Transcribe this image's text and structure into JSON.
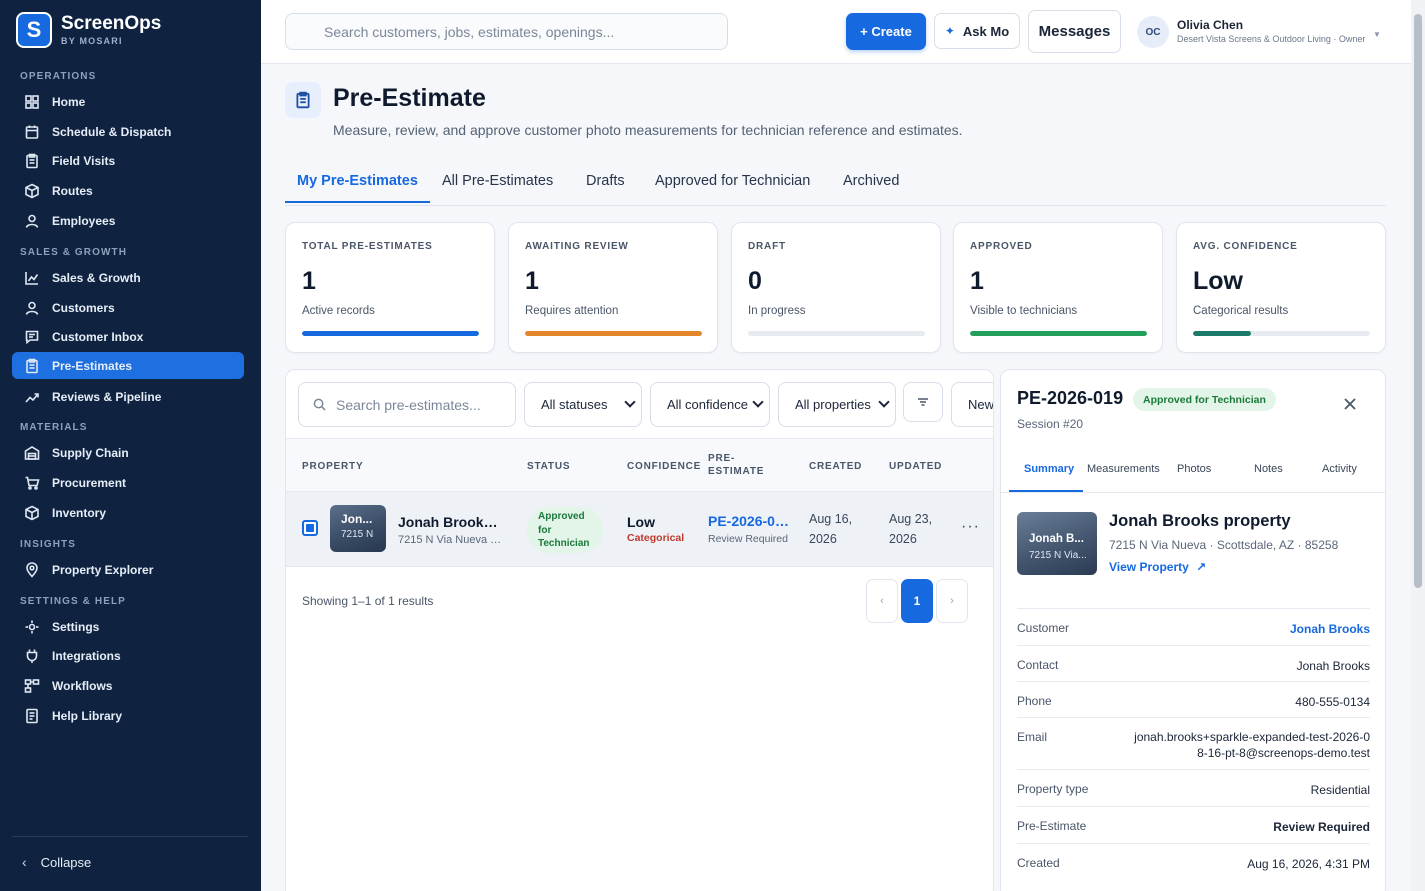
{
  "brand": {
    "logo_letter": "S",
    "name": "ScreenOps",
    "sub": "BY MOSARI"
  },
  "sidebar": {
    "sections": {
      "operations": "OPERATIONS",
      "sales": "SALES & GROWTH",
      "materials": "MATERIALS",
      "insights": "INSIGHTS",
      "settings": "SETTINGS & HELP"
    },
    "items": [
      {
        "label": "Home",
        "icon": "grid-icon"
      },
      {
        "label": "Schedule & Dispatch",
        "icon": "calendar-icon"
      },
      {
        "label": "Field Visits",
        "icon": "clipboard-icon"
      },
      {
        "label": "Routes",
        "icon": "cube-icon"
      },
      {
        "label": "Employees",
        "icon": "user-icon"
      },
      {
        "label": "Sales & Growth",
        "icon": "chart-icon"
      },
      {
        "label": "Customers",
        "icon": "user-icon"
      },
      {
        "label": "Customer Inbox",
        "icon": "message-icon"
      },
      {
        "label": "Pre-Estimates",
        "icon": "clipboard-icon"
      },
      {
        "label": "Reviews & Pipeline",
        "icon": "trend-icon"
      },
      {
        "label": "Supply Chain",
        "icon": "warehouse-icon"
      },
      {
        "label": "Procurement",
        "icon": "cart-icon"
      },
      {
        "label": "Inventory",
        "icon": "cube-icon"
      },
      {
        "label": "Property Explorer",
        "icon": "pin-icon"
      },
      {
        "label": "Settings",
        "icon": "gear-icon"
      },
      {
        "label": "Integrations",
        "icon": "plug-icon"
      },
      {
        "label": "Workflows",
        "icon": "workflow-icon"
      },
      {
        "label": "Help Library",
        "icon": "book-icon"
      }
    ],
    "collapse_label": "Collapse"
  },
  "topbar": {
    "search_placeholder": "Search customers, jobs, estimates, openings...",
    "create_label": "+ Create",
    "ask_label": "Ask Mo",
    "messages_label": "Messages",
    "user_initials": "OC",
    "user_name": "Olivia Chen",
    "user_org": "Desert Vista Screens & Outdoor Living · Owner"
  },
  "page": {
    "title": "Pre-Estimate",
    "subtitle": "Measure, review, and approve customer photo measurements for technician reference and estimates."
  },
  "tabs": [
    "My Pre-Estimates",
    "All Pre-Estimates",
    "Drafts",
    "Approved for Technician",
    "Archived"
  ],
  "stats": [
    {
      "label": "TOTAL PRE-ESTIMATES",
      "value": "1",
      "desc": "Active records",
      "fill": 1.0,
      "color": "#1769e0"
    },
    {
      "label": "AWAITING REVIEW",
      "value": "1",
      "desc": "Requires attention",
      "fill": 1.0,
      "color": "#e3862a"
    },
    {
      "label": "DRAFT",
      "value": "0",
      "desc": "In progress",
      "fill": 0.0,
      "color": "#9aa4b3"
    },
    {
      "label": "APPROVED",
      "value": "1",
      "desc": "Visible to technicians",
      "fill": 1.0,
      "color": "#22a05a"
    },
    {
      "label": "AVG. CONFIDENCE",
      "value": "Low",
      "desc": "Categorical results",
      "fill": 0.33,
      "color": "#1b7a6a"
    }
  ],
  "filters": {
    "search_placeholder": "Search pre-estimates...",
    "status": "All statuses",
    "confidence": "All confidence",
    "properties": "All properties",
    "new_label": "New"
  },
  "table": {
    "headers": {
      "property": "PROPERTY",
      "status": "STATUS",
      "confidence": "CONFIDENCE",
      "pre_estimate_1": "PRE-",
      "pre_estimate_2": "ESTIMATE",
      "created": "CREATED",
      "updated": "UPDATED"
    },
    "row": {
      "thumb_name": "Jon...",
      "thumb_addr": "7215 N",
      "property_name": "Jonah Brooks property",
      "property_addr": "7215 N Via Nueva · Scottsdale, AZ · 85258",
      "status_line1": "Approved",
      "status_line2": "for",
      "status_line3": "Technician",
      "confidence": "Low",
      "confidence_sub": "Categorical",
      "pe_id": "PE-2026-019",
      "pe_sub": "Review Required",
      "created_1": "Aug 16,",
      "created_2": "2026",
      "updated_1": "Aug 23,",
      "updated_2": "2026",
      "more": "···"
    },
    "showing": "Showing 1–1 of 1 results",
    "pagination": {
      "prev": "‹",
      "current": "1",
      "next": "›"
    }
  },
  "detail": {
    "id": "PE-2026-019",
    "badge": "Approved for Technician",
    "session": "Session #20",
    "tabs": [
      "Summary",
      "Measurements",
      "Photos",
      "Notes",
      "Activity"
    ],
    "thumb_name": "Jonah B...",
    "thumb_addr": "7215 N Via...",
    "property_name": "Jonah Brooks property",
    "property_addr": "7215 N Via Nueva · Scottsdale, AZ · 85258",
    "view_property": "View Property",
    "fields": [
      {
        "key": "Customer",
        "value": "Jonah Brooks",
        "style": "link"
      },
      {
        "key": "Contact",
        "value": "Jonah Brooks",
        "style": ""
      },
      {
        "key": "Phone",
        "value": "480-555-0134",
        "style": ""
      },
      {
        "key": "Email",
        "value": "jonah.brooks+sparkle-expanded-test-2026-08-16-pt-8@screenops-demo.test",
        "style": ""
      },
      {
        "key": "Property type",
        "value": "Residential",
        "style": ""
      },
      {
        "key": "Pre-Estimate",
        "value": "Review Required",
        "style": "bold"
      },
      {
        "key": "Created",
        "value": "Aug 16, 2026, 4:31 PM",
        "style": ""
      }
    ]
  }
}
